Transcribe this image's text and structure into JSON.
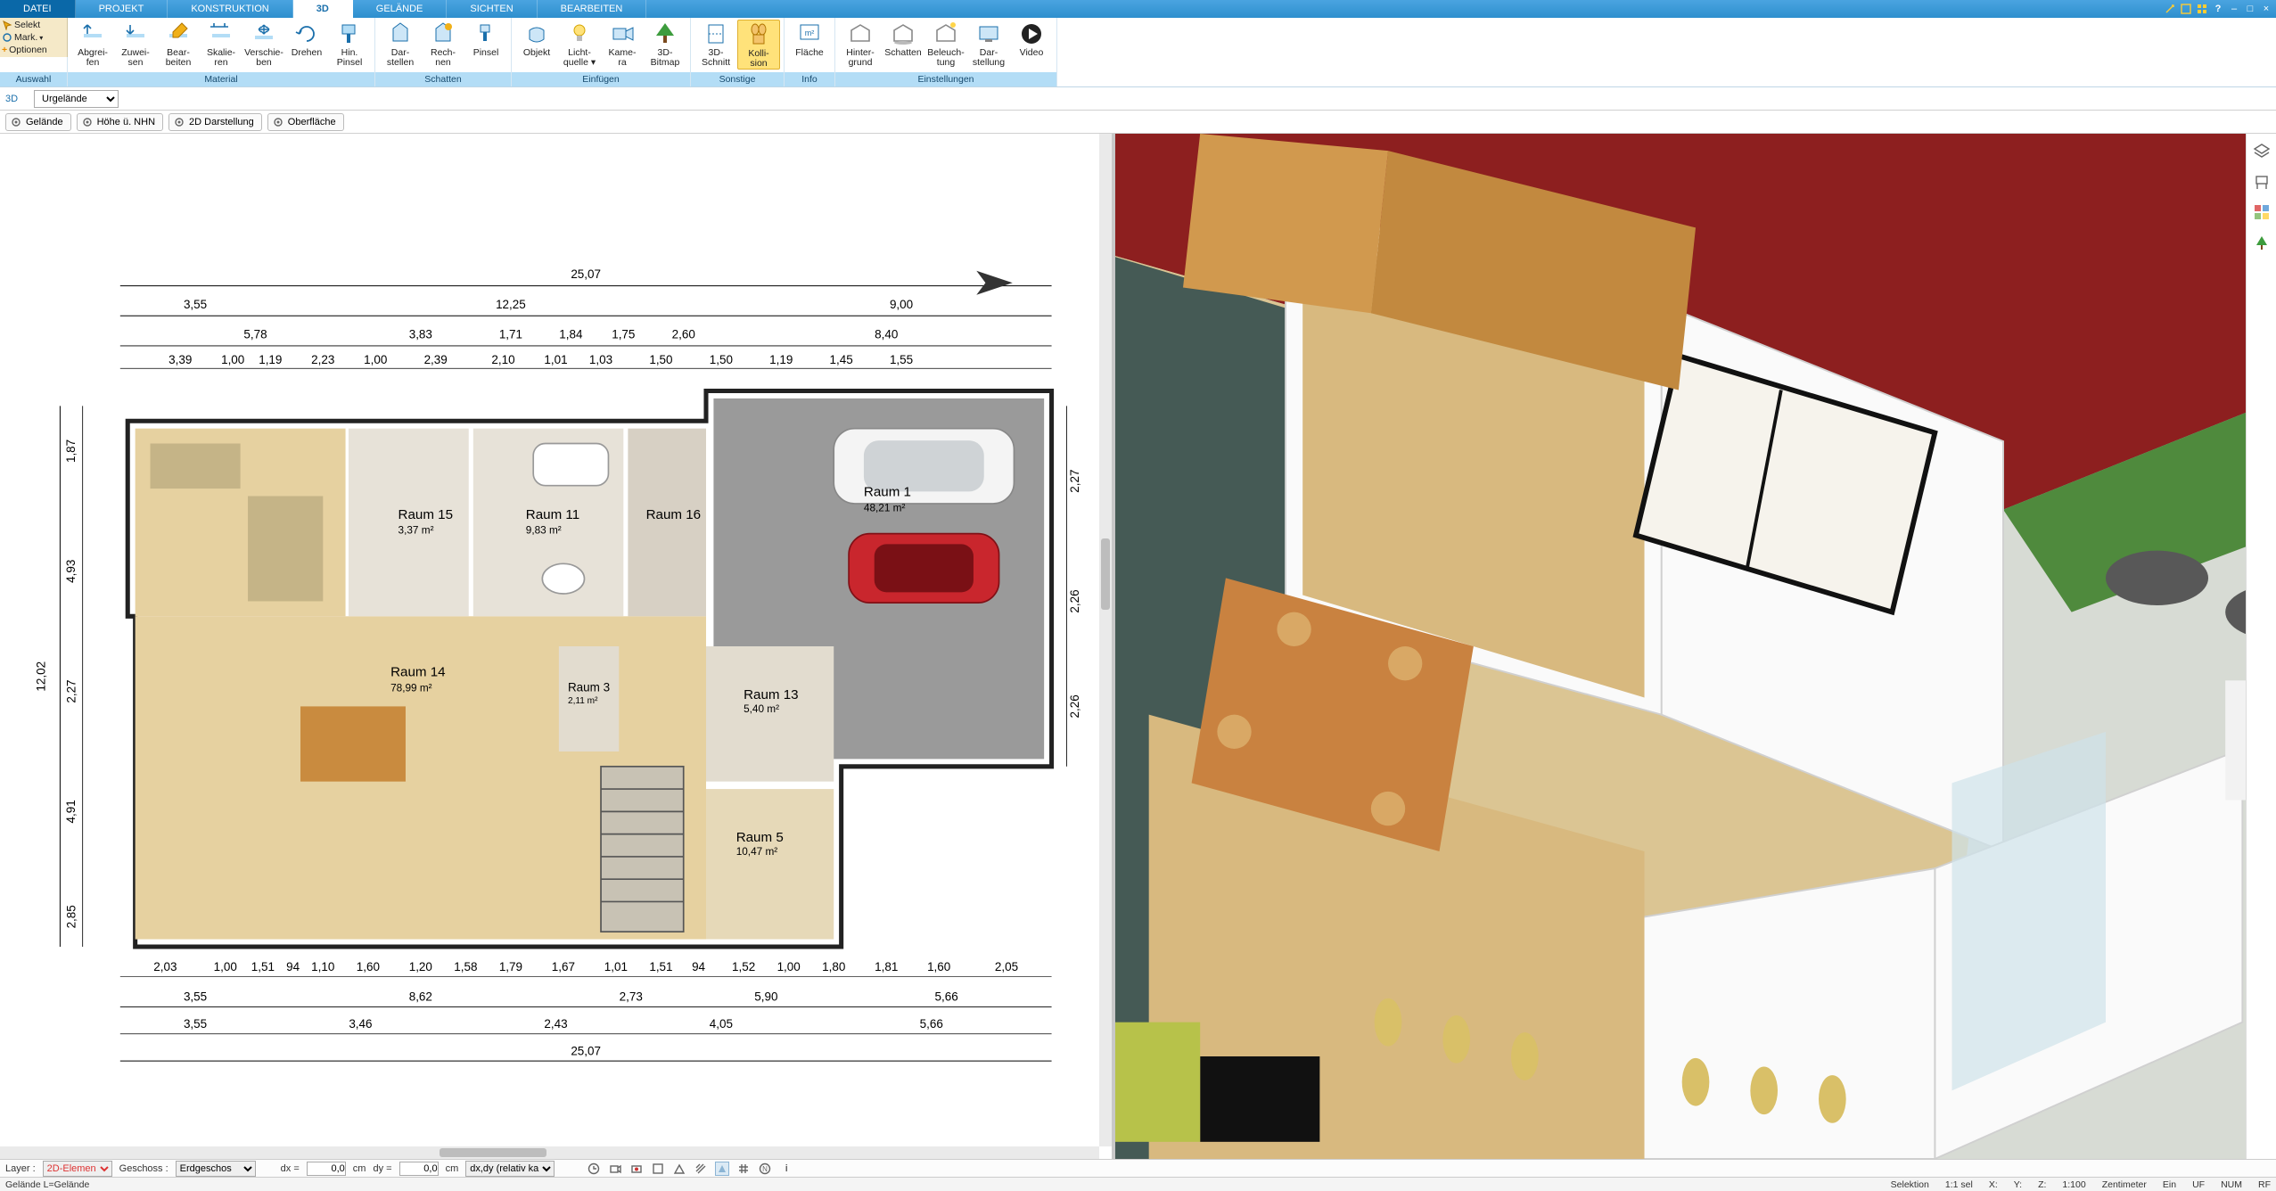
{
  "menu": {
    "tabs": [
      "DATEI",
      "PROJEKT",
      "KONSTRUKTION",
      "3D",
      "GELÄNDE",
      "SICHTEN",
      "BEARBEITEN"
    ],
    "active_index": 3
  },
  "ribbon": {
    "left": {
      "select": "Selekt",
      "mark": "Mark.",
      "optionen": "Optionen",
      "group_label": "Auswahl"
    },
    "groups": [
      {
        "id": "material",
        "label": "Material",
        "items": [
          {
            "id": "abgreifen",
            "line1": "Abgrei-",
            "line2": "fen"
          },
          {
            "id": "zuweisen",
            "line1": "Zuwei-",
            "line2": "sen"
          },
          {
            "id": "bearbeiten",
            "line1": "Bear-",
            "line2": "beiten"
          },
          {
            "id": "skalieren",
            "line1": "Skalie-",
            "line2": "ren"
          },
          {
            "id": "verschieben",
            "line1": "Verschie-",
            "line2": "ben"
          },
          {
            "id": "drehen",
            "line1": "Drehen",
            "line2": ""
          },
          {
            "id": "hinpinsel",
            "line1": "Hin.",
            "line2": "Pinsel"
          }
        ]
      },
      {
        "id": "schatten",
        "label": "Schatten",
        "items": [
          {
            "id": "darstellen",
            "line1": "Dar-",
            "line2": "stellen"
          },
          {
            "id": "rechnen",
            "line1": "Rech-",
            "line2": "nen"
          },
          {
            "id": "pinsel",
            "line1": "Pinsel",
            "line2": ""
          }
        ]
      },
      {
        "id": "einfuegen",
        "label": "Einfügen",
        "items": [
          {
            "id": "objekt",
            "line1": "Objekt",
            "line2": ""
          },
          {
            "id": "lichtquelle",
            "line1": "Licht-",
            "line2": "quelle ▾"
          },
          {
            "id": "kamera",
            "line1": "Kame-",
            "line2": "ra"
          },
          {
            "id": "bitmap3d",
            "line1": "3D-",
            "line2": "Bitmap"
          }
        ]
      },
      {
        "id": "sonstige",
        "label": "Sonstige",
        "items": [
          {
            "id": "schnitt3d",
            "line1": "3D-",
            "line2": "Schnitt"
          },
          {
            "id": "kollision",
            "line1": "Kolli-",
            "line2": "sion",
            "active": true
          }
        ]
      },
      {
        "id": "info",
        "label": "Info",
        "items": [
          {
            "id": "flaeche",
            "line1": "Fläche",
            "line2": ""
          }
        ]
      },
      {
        "id": "einstellungen",
        "label": "Einstellungen",
        "items": [
          {
            "id": "hintergrund",
            "line1": "Hinter-",
            "line2": "grund"
          },
          {
            "id": "schatten2",
            "line1": "Schatten",
            "line2": ""
          },
          {
            "id": "beleuchtung",
            "line1": "Beleuch-",
            "line2": "tung"
          },
          {
            "id": "darstellung",
            "line1": "Dar-",
            "line2": "stellung"
          },
          {
            "id": "video",
            "line1": "Video",
            "line2": ""
          }
        ]
      }
    ]
  },
  "subbar": {
    "mode": "3D",
    "terrain_select": "Urgelände"
  },
  "subbar2": {
    "pills": [
      "Gelände",
      "Höhe ü. NHN",
      "2D Darstellung",
      "Oberfläche"
    ]
  },
  "plan": {
    "dims_top_total": "25,07",
    "dims_top": [
      "3,55",
      "12,25",
      "9,00"
    ],
    "dims_top2_left": "5,78",
    "dims_top2_mid": [
      "3,83",
      "1,71",
      "1,84",
      "1,75",
      "2,60"
    ],
    "dims_top2_right": "8,40",
    "dims_top3": [
      "3,39",
      "1,00",
      "1,19",
      "2,23",
      "1,00",
      "2,39",
      "2,10",
      "1,01",
      "1,03",
      "1,50",
      "1,50",
      "1,19",
      "1,45",
      "1,55"
    ],
    "left_dims": [
      "1,87",
      "4,93",
      "2,27",
      "4,91",
      "2,85"
    ],
    "left_total": "12,02",
    "right_dims": [
      "2,27",
      "2,26",
      "2,26"
    ],
    "rooms": [
      {
        "name": "Raum 15",
        "area": "3,37 m²"
      },
      {
        "name": "Raum 11",
        "area": "9,83 m²"
      },
      {
        "name": "Raum 16",
        "area": ""
      },
      {
        "name": "Raum 1",
        "area": "48,21 m²"
      },
      {
        "name": "Raum 14",
        "area": "78,99 m²"
      },
      {
        "name": "Raum 3",
        "area": "2,11 m²"
      },
      {
        "name": "Raum 13",
        "area": "5,40 m²"
      },
      {
        "name": "Raum 5",
        "area": "10,47 m²"
      }
    ],
    "dims_bottom1": [
      "2,03",
      "1,00",
      "1,51",
      "94",
      "1,10",
      "1,60",
      "1,20",
      "1,58",
      "1,79",
      "1,67",
      "1,01",
      "1,51",
      "94",
      "1,52",
      "1,00",
      "1,80",
      "1,81",
      "1,60",
      "2,05"
    ],
    "dims_bottom2": [
      "3,55",
      "8,62",
      "2,73",
      "5,90",
      "5,66"
    ],
    "dims_bottom3": [
      "3,55",
      "3,46",
      "2,43",
      "4,05",
      "5,66"
    ],
    "dims_bottom_total": "25,07"
  },
  "bottom": {
    "layer_label": "Layer :",
    "layer_value": "2D-Elemen",
    "geschoss_label": "Geschoss :",
    "geschoss_value": "Erdgeschos",
    "dx_label": "dx =",
    "dx_value": "0,0",
    "dy_label": "dy =",
    "dy_value": "0,0",
    "unit": "cm",
    "mode": "dx,dy (relativ ka"
  },
  "status": {
    "left": "Gelände L=Gelände",
    "selektion": "Selektion",
    "sel_count": "1:1 sel",
    "x": "X:",
    "y": "Y:",
    "z": "Z:",
    "scale": "1:100",
    "unit": "Zentimeter",
    "ein": "Ein",
    "uf": "UF",
    "num": "NUM",
    "rf": "RF"
  },
  "icons": {
    "layers": "layers-icon",
    "chair": "chair-icon",
    "palette": "palette-icon",
    "tree": "tree-icon"
  }
}
